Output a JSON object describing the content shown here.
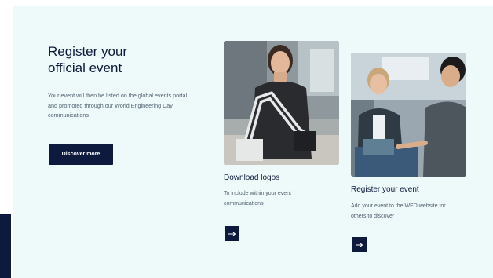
{
  "hero": {
    "title_line1": "Register your",
    "title_line2": "official event",
    "description": "Your event will then be listed on the global events portal, and promoted through our World Engineering Day communications",
    "button_label": "Discover more"
  },
  "tiles": [
    {
      "title": "Download logos",
      "description": "To include within your event communications",
      "arrow_icon": "arrow-right-icon"
    },
    {
      "title": "Register your event",
      "description": "Add your event to the WED website for others to discover",
      "arrow_icon": "arrow-right-icon"
    }
  ],
  "colors": {
    "navy": "#0d1a3d",
    "background": "#eefafa",
    "text_muted": "#506070"
  }
}
